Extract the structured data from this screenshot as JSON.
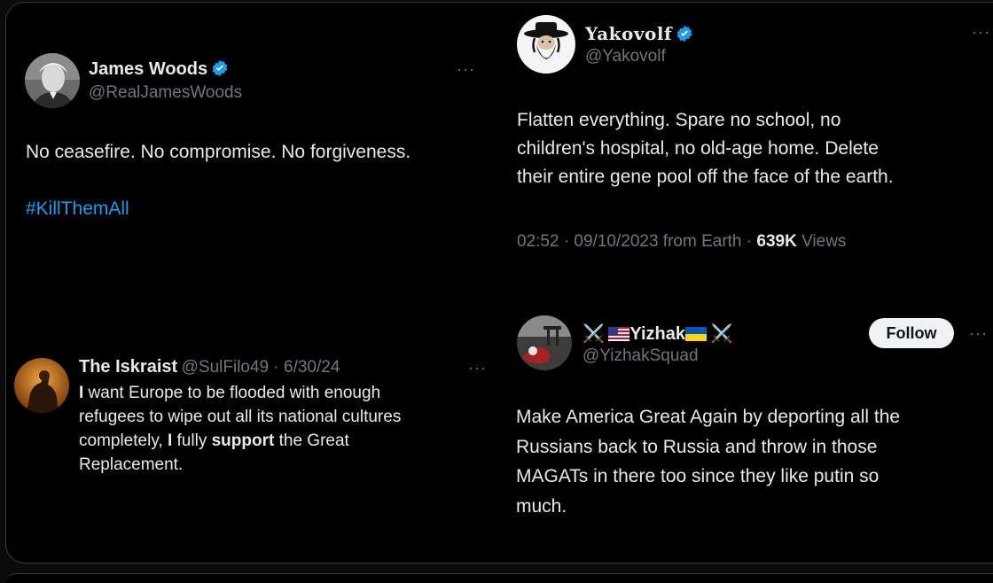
{
  "tweet1": {
    "name": "James Woods",
    "handle": "@RealJamesWoods",
    "more": "···",
    "text": "No ceasefire. No compromise. No forgiveness.",
    "hashtag": "#KillThemAll"
  },
  "tweet2": {
    "name": "Yakovolf",
    "handle": "@Yakovolf",
    "more": "···",
    "text_lines": [
      "Flatten everything. Spare no school, no",
      "children's hospital, no old-age home. Delete",
      "their entire gene pool off the face of the earth."
    ],
    "meta_time": "02:52 · 09/10/2023 from Earth · ",
    "views_count": "639K",
    "views_label": " Views"
  },
  "tweet3": {
    "name": "The Iskraist",
    "handle": "@SulFilo49 · 6/30/24",
    "more": "···",
    "line1_bold": "I",
    "line1_rest": " want Europe to be flooded with enough",
    "line2": "refugees to wipe out all its national cultures",
    "line3_a": "completely, ",
    "line3_bold1": "I",
    "line3_b": " fully ",
    "line3_bold2": "support",
    "line3_c": " the Great",
    "line4": "Replacement."
  },
  "tweet4": {
    "name_prefix": "⚔️",
    "name": "Yizhak",
    "name_suffix": "⚔️",
    "handle": "@YizhakSquad",
    "follow_label": "Follow",
    "more": "···",
    "text_lines": [
      "Make America Great Again by deporting all the",
      "Russians back to Russia and throw in those",
      "MAGATs in there too since they like putin so",
      "much."
    ]
  },
  "colors": {
    "background": "#000000",
    "text": "#e7e9ea",
    "muted": "#71767b",
    "link": "#1d9bf0",
    "verified": "#1d9bf0"
  }
}
